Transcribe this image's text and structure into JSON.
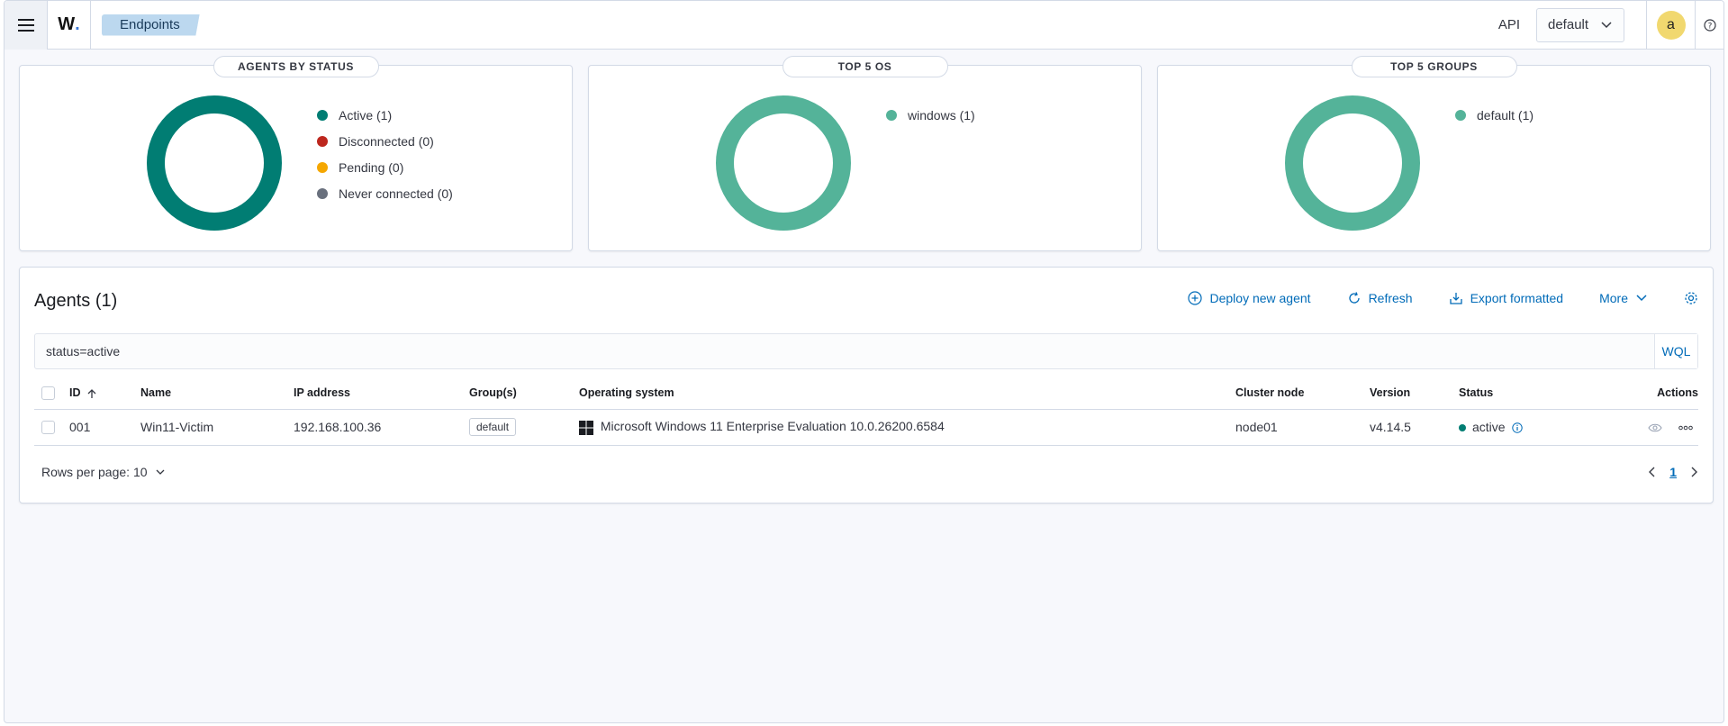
{
  "header": {
    "breadcrumb": "Endpoints",
    "logo_text": "W",
    "api_label": "API",
    "api_select_value": "default",
    "avatar_initial": "a"
  },
  "panels": [
    {
      "title": "AGENTS BY STATUS",
      "legend": [
        {
          "label": "Active (1)",
          "color": "#017d73"
        },
        {
          "label": "Disconnected (0)",
          "color": "#bd271e"
        },
        {
          "label": "Pending (0)",
          "color": "#f5a700"
        },
        {
          "label": "Never connected (0)",
          "color": "#69707d"
        }
      ],
      "ring_color": "#017d73"
    },
    {
      "title": "TOP 5 OS",
      "legend": [
        {
          "label": "windows (1)",
          "color": "#54b399"
        }
      ],
      "ring_color": "#54b399"
    },
    {
      "title": "TOP 5 GROUPS",
      "legend": [
        {
          "label": "default (1)",
          "color": "#54b399"
        }
      ],
      "ring_color": "#54b399"
    }
  ],
  "agents": {
    "title": "Agents (1)",
    "toolbar": {
      "deploy": "Deploy new agent",
      "refresh": "Refresh",
      "export": "Export formatted",
      "more": "More"
    },
    "search_value": "status=active",
    "wql": "WQL",
    "columns": {
      "id": "ID",
      "name": "Name",
      "ip": "IP address",
      "groups": "Group(s)",
      "os": "Operating system",
      "cluster": "Cluster node",
      "version": "Version",
      "status": "Status",
      "actions": "Actions"
    },
    "rows": [
      {
        "id": "001",
        "name": "Win11-Victim",
        "ip": "192.168.100.36",
        "group": "default",
        "os": "Microsoft Windows 11 Enterprise Evaluation 10.0.26200.6584",
        "cluster": "node01",
        "version": "v4.14.5",
        "status": "active",
        "status_color": "#017d73"
      }
    ],
    "rows_per_page": "Rows per page: 10",
    "current_page": "1"
  }
}
